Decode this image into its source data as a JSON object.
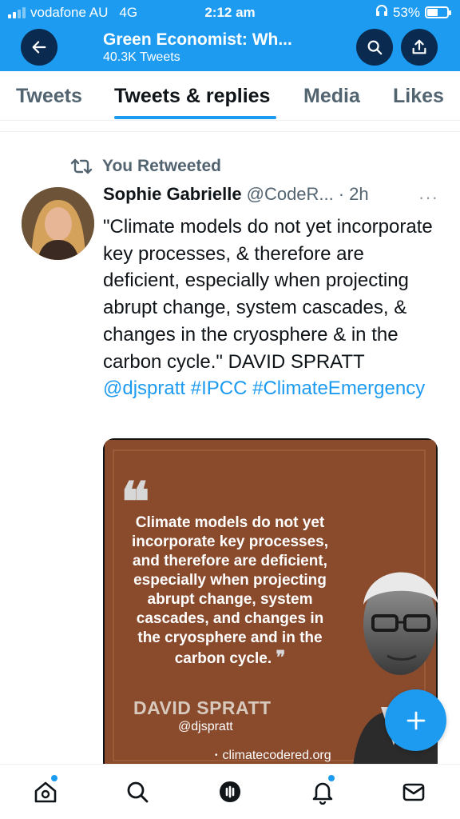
{
  "status_bar": {
    "carrier": "vodafone AU",
    "network": "4G",
    "time": "2:12 am",
    "battery_percent": "53%",
    "battery_level": 0.53
  },
  "header": {
    "title": "Green Economist: Wh...",
    "subtitle": "40.3K Tweets",
    "back_icon": "arrow-left-icon",
    "search_icon": "search-icon",
    "share_icon": "share-icon"
  },
  "tabs": [
    {
      "label": "Tweets",
      "active": false
    },
    {
      "label": "Tweets & replies",
      "active": true
    },
    {
      "label": "Media",
      "active": false
    },
    {
      "label": "Likes",
      "active": false
    }
  ],
  "tweet": {
    "retweet_label": "You Retweeted",
    "author_name": "Sophie Gabrielle",
    "author_handle": "@CodeR...",
    "separator": "·",
    "time": "2h",
    "more": "···",
    "text_main": "\"Climate models do not yet incorporate key processes, & therefore are deficient, especially when projecting abrupt change, system cascades, & changes in the cryosphere & in the carbon cycle.\" DAVID SPRATT",
    "mention": "@djspratt",
    "hashtag1": "#IPCC",
    "hashtag2": "#ClimateEmergency",
    "media": {
      "open_quote": "❝",
      "quote": "Climate models do not yet incorporate key processes, and therefore are deficient, especially when projecting abrupt change, system cascades, and changes in the cryosphere and in the carbon cycle.",
      "close_quote": "❞",
      "author": "DAVID SPRATT",
      "handle": "@djspratt",
      "site": "climatecodered.org"
    }
  },
  "fab": {
    "icon": "plus-icon"
  },
  "bottom_nav": [
    {
      "icon": "home-icon",
      "badge": true
    },
    {
      "icon": "search-icon",
      "badge": false
    },
    {
      "icon": "spaces-icon",
      "badge": false
    },
    {
      "icon": "bell-icon",
      "badge": true
    },
    {
      "icon": "mail-icon",
      "badge": false
    }
  ],
  "colors": {
    "accent": "#1d9bf0",
    "header_button": "#0a2a50",
    "media_background": "#8a4a2c",
    "text_secondary": "#536471"
  }
}
